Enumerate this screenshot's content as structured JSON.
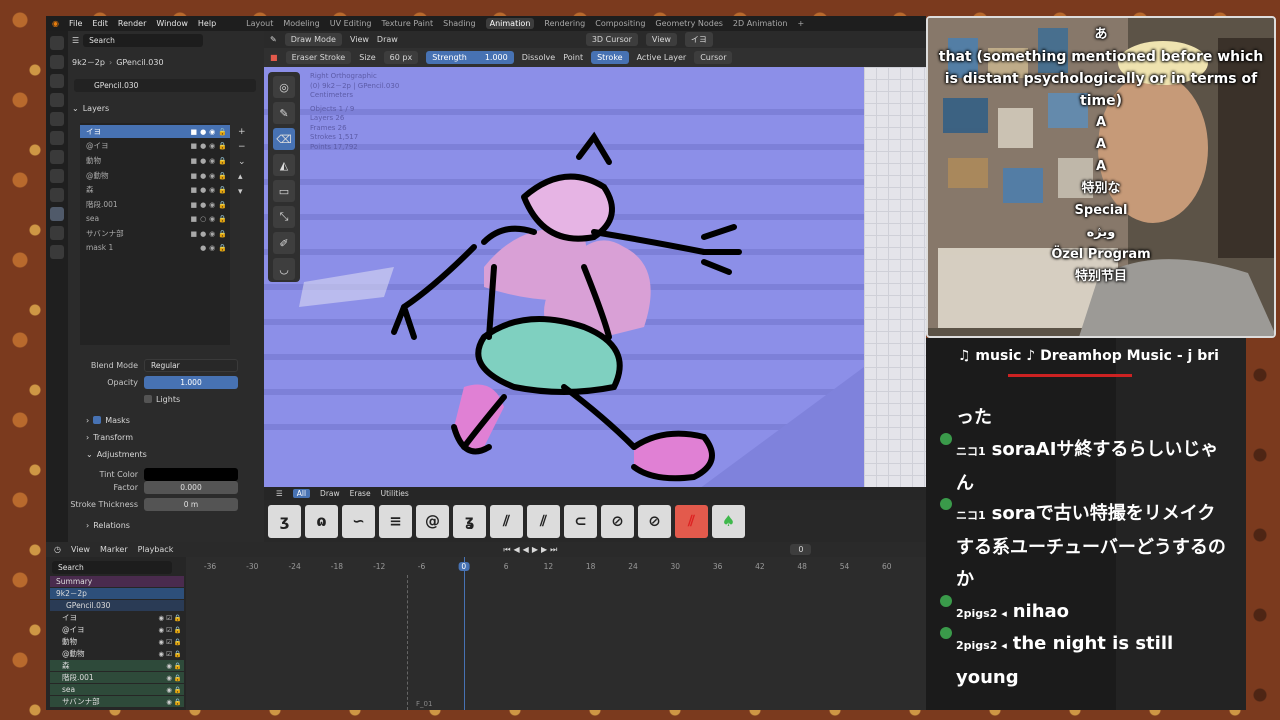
{
  "app": {
    "menus": [
      "File",
      "Edit",
      "Render",
      "Window",
      "Help"
    ],
    "workspaces": [
      "Layout",
      "Modeling",
      "UV Editing",
      "Texture Paint",
      "Shading",
      "Animation",
      "Rendering",
      "Compositing",
      "Geometry Nodes",
      "2D Animation"
    ],
    "active_workspace": "Animation"
  },
  "properties": {
    "search_placeholder": "Search",
    "object_name": "9k2－2p",
    "data_name": "GPencil.030",
    "datablock": "GPencil.030",
    "layers_header": "Layers",
    "layers": [
      {
        "name": "イヨ",
        "selected": true
      },
      {
        "name": "@イヨ"
      },
      {
        "name": "動物"
      },
      {
        "name": "@動物"
      },
      {
        "name": "森"
      },
      {
        "name": "階段.001"
      },
      {
        "name": "sea"
      },
      {
        "name": "サバンナ部"
      },
      {
        "name": "mask 1"
      }
    ],
    "blend_mode_label": "Blend Mode",
    "blend_mode": "Regular",
    "opacity_label": "Opacity",
    "opacity": "1.000",
    "lights_label": "Lights",
    "masks_label": "Masks",
    "transform_label": "Transform",
    "adjustments_label": "Adjustments",
    "tint_color_label": "Tint Color",
    "factor_label": "Factor",
    "factor": "0.000",
    "stroke_thickness_label": "Stroke Thickness",
    "stroke_thickness": "0 m",
    "relations_label": "Relations"
  },
  "viewport": {
    "mode": "Draw Mode",
    "view": "View",
    "draw": "Draw",
    "cursor": "3D Cursor",
    "view2": "View",
    "layer": "イヨ",
    "tool": "Eraser Stroke",
    "size_label": "Size",
    "size": "60 px",
    "strength_label": "Strength",
    "strength": "1.000",
    "dissolve": "Dissolve",
    "point": "Point",
    "stroke": "Stroke",
    "active_layer": "Active Layer",
    "cursor2": "Cursor",
    "overlay": [
      "Right Orthographic",
      "(0) 9k2－2p | GPencil.030",
      "Centimeters",
      "Objects   1 / 9",
      "Layers    26",
      "Frames    26",
      "Strokes   1,517",
      "Points    17,792"
    ]
  },
  "brushbar": {
    "tabs": [
      "All",
      "Draw",
      "Erase",
      "Utilities"
    ],
    "active": "All"
  },
  "brushes": [
    "ʒ",
    "ɷ",
    "∽",
    "≡",
    "@",
    "ʓ",
    "⫽",
    "⫽",
    "⊂",
    "⊘",
    "⊘",
    "⫽",
    "♠"
  ],
  "timeline": {
    "view": "View",
    "marker": "Marker",
    "playback": "Playback",
    "current_frame": "0",
    "search_placeholder": "Search",
    "ticks": [
      "-36",
      "-30",
      "-24",
      "-18",
      "-12",
      "-6",
      "0",
      "6",
      "12",
      "18",
      "24",
      "30",
      "36",
      "42",
      "48",
      "54",
      "60"
    ],
    "frame_marker": "F_01",
    "channels": [
      {
        "name": "Summary",
        "kind": "summary"
      },
      {
        "name": "9k2－2p",
        "kind": "object"
      },
      {
        "name": "GPencil.030",
        "kind": "data"
      },
      {
        "name": "イヨ",
        "kind": "layer"
      },
      {
        "name": "@イヨ",
        "kind": "layer"
      },
      {
        "name": "動物",
        "kind": "layer"
      },
      {
        "name": "@動物",
        "kind": "layer"
      },
      {
        "name": "森",
        "kind": "group"
      },
      {
        "name": "階段.001",
        "kind": "group"
      },
      {
        "name": "sea",
        "kind": "group"
      },
      {
        "name": "サバンナ部",
        "kind": "group"
      }
    ]
  },
  "stream": {
    "captions": [
      "あ",
      "that (something mentioned before which is distant psychologically or in terms of time)",
      "A",
      "A",
      "A",
      "特別な",
      "Special",
      "ویژه",
      "Özel Program",
      "特别节目"
    ],
    "music": "♫ music ♪ Dreamhop Music - j bri",
    "chat": [
      {
        "user": "",
        "text": "った"
      },
      {
        "user": "ニコ1",
        "text": "soraAIサ終するらしいじゃん"
      },
      {
        "user": "ニコ1",
        "text": "soraで古い特撮をリメイクする系ユーチューバーどうするのか"
      },
      {
        "user": "2pigs2 ◂",
        "text": "nihao"
      },
      {
        "user": "2pigs2 ◂",
        "text": "the night is still young"
      }
    ]
  }
}
